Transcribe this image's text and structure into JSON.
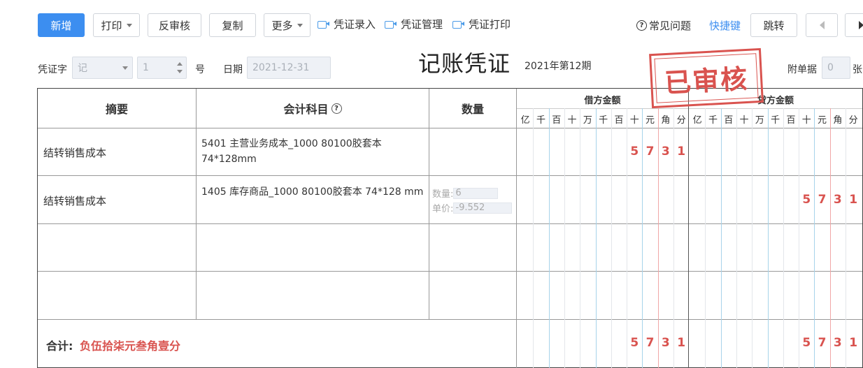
{
  "toolbar": {
    "add": "新增",
    "print": "打印",
    "unaudit": "反审核",
    "copy": "复制",
    "more": "更多",
    "voucher_entry": "凭证录入",
    "voucher_manage": "凭证管理",
    "voucher_print": "凭证打印",
    "faq": "常见问题",
    "shortcut": "快捷键",
    "jump": "跳转"
  },
  "header": {
    "voucher_word_label": "凭证字",
    "voucher_word_value": "记",
    "voucher_no_value": "1",
    "no_suffix": "号",
    "date_label": "日期",
    "date_value": "2021-12-31",
    "title": "记账凭证",
    "period": "2021年第12期",
    "attach_label": "附单据",
    "attach_value": "0",
    "attach_unit": "张",
    "stamp": "已审核"
  },
  "table": {
    "col_summary": "摘要",
    "col_subject": "会计科目",
    "col_qty": "数量",
    "debit_caption": "借方金额",
    "credit_caption": "贷方金额",
    "units": [
      "亿",
      "千",
      "百",
      "十",
      "万",
      "千",
      "百",
      "十",
      "元",
      "角",
      "分"
    ],
    "rows": [
      {
        "summary": "结转销售成本",
        "subject": "5401 主营业务成本_1000 80100胶套本 74*128mm",
        "debit": [
          "",
          "",
          "",
          "",
          "",
          "",
          "",
          "5",
          "7",
          "3",
          "1"
        ],
        "credit": [
          "",
          "",
          "",
          "",
          "",
          "",
          "",
          "",
          "",
          "",
          ""
        ]
      },
      {
        "summary": "结转销售成本",
        "subject": "1405 库存商品_1000 80100胶套本 74*128 mm",
        "qty_label": "数量:",
        "qty_value": "6",
        "price_label": "单价:",
        "price_value": "-9.552",
        "debit": [
          "",
          "",
          "",
          "",
          "",
          "",
          "",
          "",
          "",
          "",
          ""
        ],
        "credit": [
          "",
          "",
          "",
          "",
          "",
          "",
          "",
          "5",
          "7",
          "3",
          "1"
        ]
      }
    ],
    "total_label": "合计:",
    "total_value": "负伍拾柒元叁角壹分",
    "total_debit": [
      "",
      "",
      "",
      "",
      "",
      "",
      "",
      "5",
      "7",
      "3",
      "1"
    ],
    "total_credit": [
      "",
      "",
      "",
      "",
      "",
      "",
      "",
      "5",
      "7",
      "3",
      "1"
    ]
  },
  "colors": {
    "primary": "#3c8ef0",
    "stamp_red": "#d9534f",
    "amount_red": "#d9534f"
  }
}
